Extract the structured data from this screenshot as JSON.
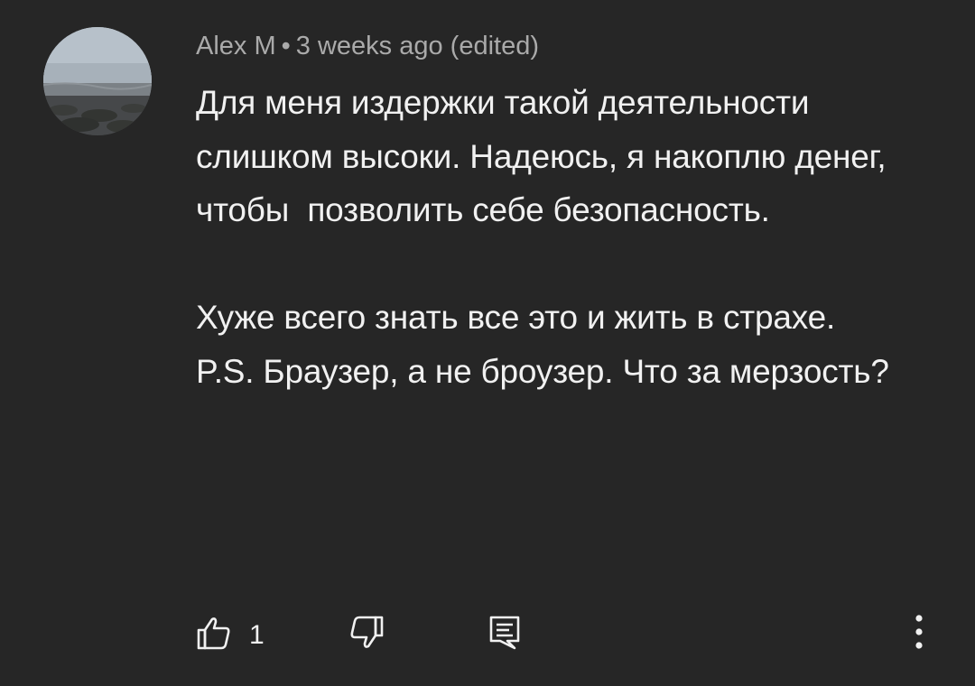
{
  "comment": {
    "author": "Alex M",
    "separator": "•",
    "time": "3 weeks ago (edited)",
    "text": "Для меня издержки такой деятельности слишком высоки. Надеюсь, я накоплю денег, чтобы  позволить себе безопасность.\n\nХуже всего знать все это и жить в страхе.\nP.S. Браузер, а не броузер. Что за мерзость?",
    "like_count": "1"
  },
  "icons": {
    "avatar": "avatar-seascape",
    "like": "thumbs-up-icon",
    "dislike": "thumbs-down-icon",
    "reply": "reply-comment-icon",
    "more": "more-vertical-icon"
  },
  "colors": {
    "background": "#262626",
    "text": "#f1f1f1",
    "meta_text": "#aaaaaa"
  }
}
